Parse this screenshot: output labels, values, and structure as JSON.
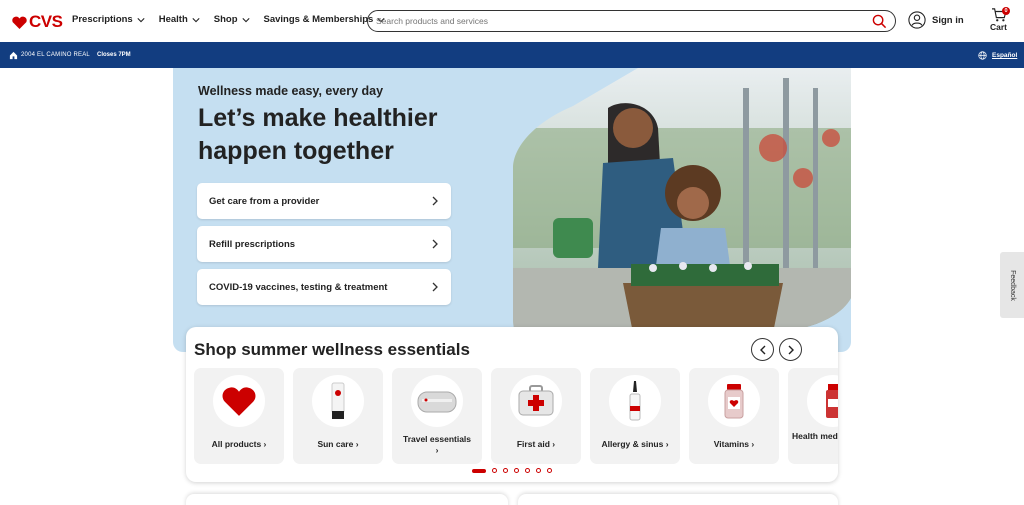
{
  "header": {
    "logo_text": "CVS",
    "nav": [
      {
        "label": "Prescriptions"
      },
      {
        "label": "Health"
      },
      {
        "label": "Shop"
      },
      {
        "label": "Savings & Memberships"
      }
    ],
    "search_placeholder": "Search products and services",
    "signin_label": "Sign in",
    "cart_label": "Cart",
    "cart_count": "0"
  },
  "storebar": {
    "address": "2004 EL CAMINO REAL",
    "hours": "Closes 7PM",
    "language": "Español"
  },
  "hero": {
    "eyebrow": "Wellness made easy, every day",
    "title": "Let’s make healthier happen together",
    "buttons": [
      {
        "label": "Get care from a provider"
      },
      {
        "label": "Refill prescriptions"
      },
      {
        "label": "COVID-19 vaccines, testing & treatment"
      }
    ]
  },
  "feedback_label": "Feedback",
  "shop": {
    "title": "Shop summer wellness essentials",
    "tiles": [
      {
        "label": "All products",
        "icon": "heart-icon"
      },
      {
        "label": "Sun care",
        "icon": "sunscreen-icon"
      },
      {
        "label": "Travel essentials",
        "icon": "travel-bag-icon"
      },
      {
        "label": "First aid",
        "icon": "first-aid-kit-icon"
      },
      {
        "label": "Allergy & sinus",
        "icon": "nasal-spray-icon"
      },
      {
        "label": "Vitamins",
        "icon": "vitamin-bottle-icon"
      },
      {
        "label": "Health medic",
        "icon": "medicine-bottle-icon"
      }
    ],
    "pages": 7,
    "active_page": 1
  },
  "colors": {
    "brand_red": "#cc0000",
    "store_bar": "#123d80",
    "hero_bg": "#c5dff1"
  }
}
